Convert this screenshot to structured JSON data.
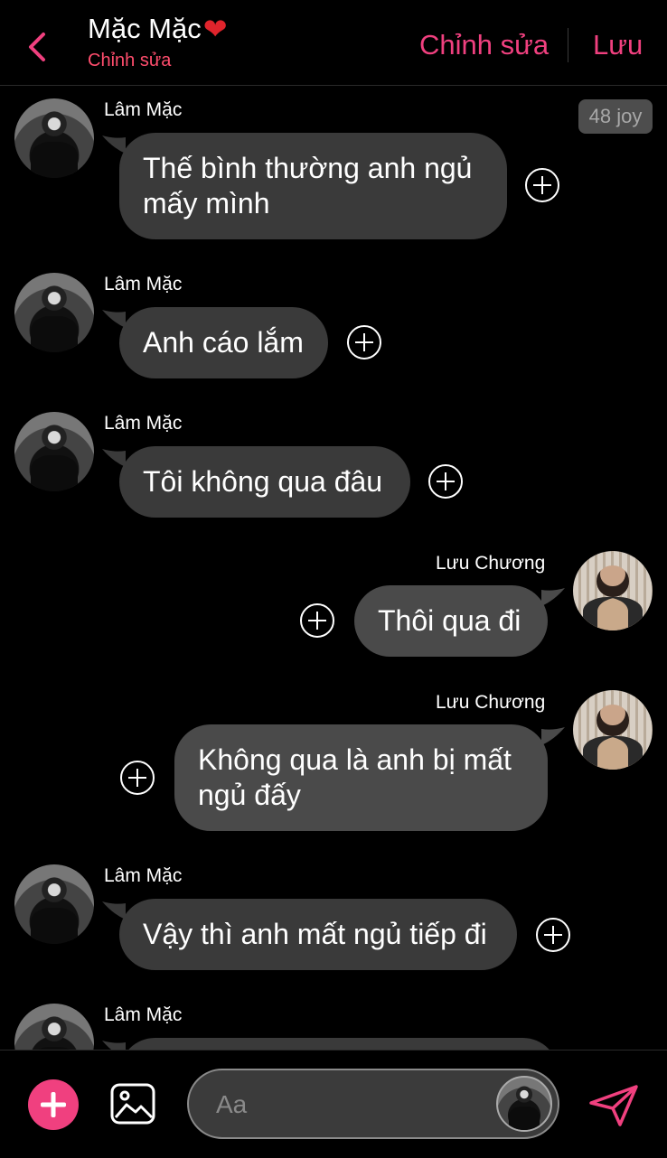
{
  "header": {
    "title": "Mặc Mặc",
    "heart": "❤️",
    "subtitle": "Chỉnh sửa",
    "edit_label": "Chỉnh sửa",
    "save_label": "Lưu"
  },
  "joy_badge": "48 joy",
  "messages": [
    {
      "sender": "Lâm Mặc",
      "side": "left",
      "text": "Thế bình thường anh ngủ mấy mình"
    },
    {
      "sender": "Lâm Mặc",
      "side": "left",
      "text": "Anh cáo lắm"
    },
    {
      "sender": "Lâm Mặc",
      "side": "left",
      "text": "Tôi không qua đâu"
    },
    {
      "sender": "Lưu Chương",
      "side": "right",
      "text": "Thôi qua đi"
    },
    {
      "sender": "Lưu Chương",
      "side": "right",
      "text": "Không qua là anh bị mất ngủ đấy"
    },
    {
      "sender": "Lâm Mặc",
      "side": "left",
      "text": "Vậy thì anh mất ngủ tiếp đi"
    },
    {
      "sender": "Lâm Mặc",
      "side": "left",
      "text": ""
    }
  ],
  "input": {
    "placeholder": "Aa"
  },
  "colors": {
    "accent": "#f0407f",
    "bubble_left": "#3a3a3a",
    "bubble_right": "#4a4a4a"
  },
  "icons": {
    "back": "chevron-left-icon",
    "add": "plus-circle-icon",
    "image": "image-icon",
    "send": "send-icon",
    "message_add": "plus-circle-outline-icon"
  }
}
